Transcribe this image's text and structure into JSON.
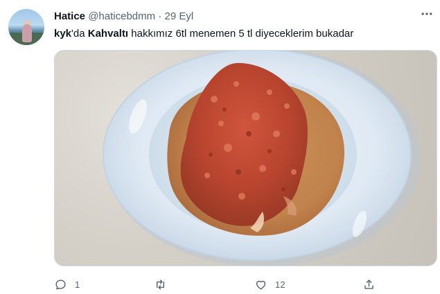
{
  "tweet": {
    "author_name": "Hatice",
    "handle": "@haticebdmm",
    "separator": "·",
    "date": "29 Eyl",
    "text": {
      "part1": "kyk",
      "part2": "'da ",
      "part3": "Kahvaltı",
      "part4": " hakkımız 6tl  menemen 5 tl diyeceklerim bukadar"
    },
    "more_icon": "more-horizontal-icon"
  },
  "actions": {
    "reply_count": "1",
    "retweet_count": "",
    "like_count": "12",
    "icons": [
      "reply-icon",
      "retweet-icon",
      "like-icon",
      "share-icon"
    ]
  },
  "colors": {
    "text_primary": "#0f1419",
    "text_secondary": "#536471",
    "border": "#cfd9de"
  }
}
